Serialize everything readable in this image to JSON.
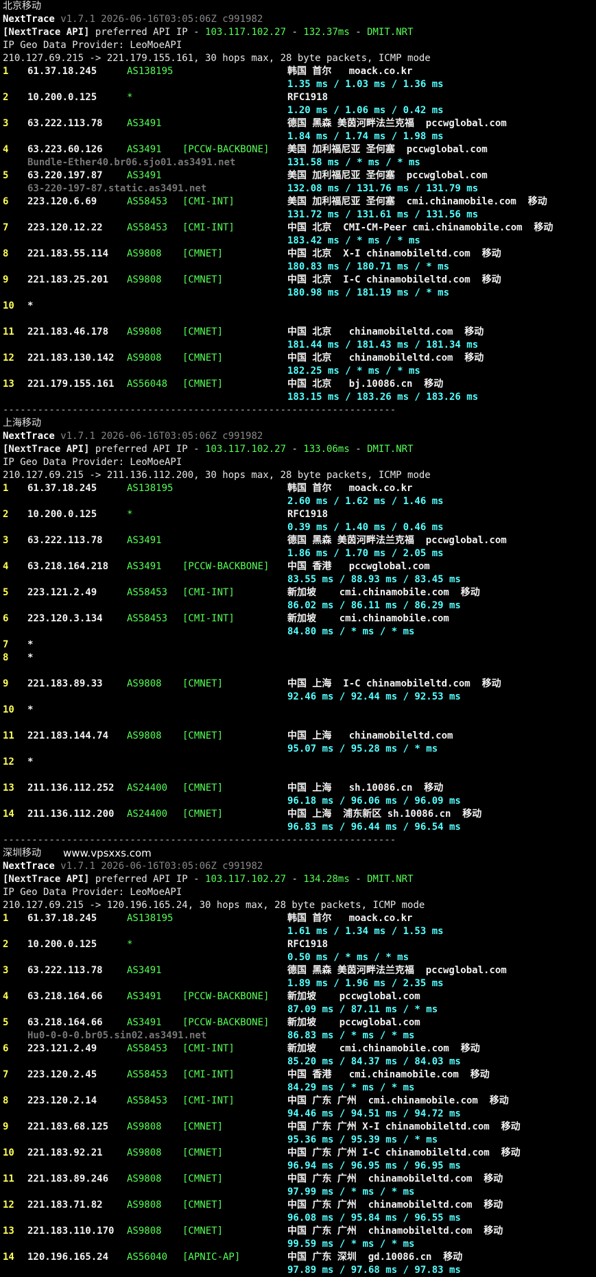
{
  "watermark": "www.vpsxxs.com",
  "sections": [
    {
      "title": "北京移动",
      "nt_name": "NextTrace",
      "nt_version": "v1.7.1 2026-06-16T03:05:06Z c991982",
      "api_prefix": "[NextTrace API]",
      "api_mid": " preferred API IP - ",
      "api_ip": "103.117.102.27",
      "api_sep": " - ",
      "api_ms": "132.37ms",
      "api_sep2": " - ",
      "api_dc": "DMIT.NRT",
      "geo_provider": "IP Geo Data Provider: LeoMoeAPI",
      "trace_header": "210.127.69.215 -> 221.179.155.161, 30 hops max, 28 byte packets, ICMP mode",
      "separator": "--------------------------------------------------------------------",
      "hops": [
        {
          "n": "1",
          "ip": "61.37.18.245",
          "as": "AS138195",
          "tag": "",
          "geo": "韩国 首尔   moack.co.kr",
          "rdns": "",
          "rtt": "1.35 ms / 1.03 ms / 1.36 ms"
        },
        {
          "n": "2",
          "ip": "10.200.0.125",
          "as": "*",
          "tag": "",
          "geo": "RFC1918",
          "rdns": "",
          "rtt": "1.20 ms / 1.06 ms / 0.42 ms"
        },
        {
          "n": "3",
          "ip": "63.222.113.78",
          "as": "AS3491",
          "tag": "",
          "geo": "德国 黑森 美茵河畔法兰克福  pccwglobal.com",
          "rdns": "",
          "rtt": "1.84 ms / 1.74 ms / 1.98 ms"
        },
        {
          "n": "4",
          "ip": "63.223.60.126",
          "as": "AS3491",
          "tag": "[PCCW-BACKBONE]",
          "geo": "美国 加利福尼亚 圣何塞  pccwglobal.com",
          "rdns": "Bundle-Ether40.br06.sjo01.as3491.net",
          "rtt": "131.58 ms / * ms / * ms"
        },
        {
          "n": "5",
          "ip": "63.220.197.87",
          "as": "AS3491",
          "tag": "",
          "geo": "美国 加利福尼亚 圣何塞  pccwglobal.com",
          "rdns": "63-220-197-87.static.as3491.net",
          "rtt": "132.08 ms / 131.76 ms / 131.79 ms"
        },
        {
          "n": "6",
          "ip": "223.120.6.69",
          "as": "AS58453",
          "tag": "[CMI-INT]",
          "geo": "美国 加利福尼亚 圣何塞  cmi.chinamobile.com  移动",
          "rdns": "",
          "rtt": "131.72 ms / 131.61 ms / 131.56 ms"
        },
        {
          "n": "7",
          "ip": "223.120.12.22",
          "as": "AS58453",
          "tag": "[CMI-INT]",
          "geo": "中国 北京  CMI-CM-Peer cmi.chinamobile.com  移动",
          "rdns": "",
          "rtt": "183.42 ms / * ms / * ms"
        },
        {
          "n": "8",
          "ip": "221.183.55.114",
          "as": "AS9808",
          "tag": "[CMNET]",
          "geo": "中国 北京  X-I chinamobileltd.com  移动",
          "rdns": "",
          "rtt": "180.83 ms / 180.71 ms / * ms"
        },
        {
          "n": "9",
          "ip": "221.183.25.201",
          "as": "AS9808",
          "tag": "[CMNET]",
          "geo": "中国 北京  I-C chinamobileltd.com  移动",
          "rdns": "",
          "rtt": "180.98 ms / 181.19 ms / * ms"
        },
        {
          "n": "10",
          "ip": "*",
          "as": "",
          "tag": "",
          "geo": "",
          "rdns": "",
          "rtt": ""
        },
        {
          "n": "11",
          "ip": "221.183.46.178",
          "as": "AS9808",
          "tag": "[CMNET]",
          "geo": "中国 北京   chinamobileltd.com  移动",
          "rdns": "",
          "rtt": "181.44 ms / 181.43 ms / 181.34 ms"
        },
        {
          "n": "12",
          "ip": "221.183.130.142",
          "as": "AS9808",
          "tag": "[CMNET]",
          "geo": "中国 北京   chinamobileltd.com  移动",
          "rdns": "",
          "rtt": "182.25 ms / * ms / * ms"
        },
        {
          "n": "13",
          "ip": "221.179.155.161",
          "as": "AS56048",
          "tag": "[CMNET]",
          "geo": "中国 北京   bj.10086.cn  移动",
          "rdns": "",
          "rtt": "183.15 ms / 183.26 ms / 183.26 ms"
        }
      ]
    },
    {
      "title": "上海移动",
      "nt_name": "NextTrace",
      "nt_version": "v1.7.1 2026-06-16T03:05:06Z c991982",
      "api_prefix": "[NextTrace API]",
      "api_mid": " preferred API IP - ",
      "api_ip": "103.117.102.27",
      "api_sep": " - ",
      "api_ms": "133.06ms",
      "api_sep2": " - ",
      "api_dc": "DMIT.NRT",
      "geo_provider": "IP Geo Data Provider: LeoMoeAPI",
      "trace_header": "210.127.69.215 -> 211.136.112.200, 30 hops max, 28 byte packets, ICMP mode",
      "separator": "--------------------------------------------------------------------",
      "hops": [
        {
          "n": "1",
          "ip": "61.37.18.245",
          "as": "AS138195",
          "tag": "",
          "geo": "韩国 首尔   moack.co.kr",
          "rdns": "",
          "rtt": "2.60 ms / 1.62 ms / 1.46 ms"
        },
        {
          "n": "2",
          "ip": "10.200.0.125",
          "as": "*",
          "tag": "",
          "geo": "RFC1918",
          "rdns": "",
          "rtt": "0.39 ms / 1.40 ms / 0.46 ms"
        },
        {
          "n": "3",
          "ip": "63.222.113.78",
          "as": "AS3491",
          "tag": "",
          "geo": "德国 黑森 美茵河畔法兰克福  pccwglobal.com",
          "rdns": "",
          "rtt": "1.86 ms / 1.70 ms / 2.05 ms"
        },
        {
          "n": "4",
          "ip": "63.218.164.218",
          "as": "AS3491",
          "tag": "[PCCW-BACKBONE]",
          "geo": "中国 香港   pccwglobal.com",
          "rdns": "",
          "rtt": "83.55 ms / 88.93 ms / 83.45 ms"
        },
        {
          "n": "5",
          "ip": "223.121.2.49",
          "as": "AS58453",
          "tag": "[CMI-INT]",
          "geo": "新加坡    cmi.chinamobile.com  移动",
          "rdns": "",
          "rtt": "86.02 ms / 86.11 ms / 86.29 ms"
        },
        {
          "n": "6",
          "ip": "223.120.3.134",
          "as": "AS58453",
          "tag": "[CMI-INT]",
          "geo": "新加坡    cmi.chinamobile.com",
          "rdns": "",
          "rtt": "84.80 ms / * ms / * ms"
        },
        {
          "n": "7",
          "ip": "*",
          "as": "",
          "tag": "",
          "geo": "",
          "rdns": "",
          "rtt": "",
          "compact": true
        },
        {
          "n": "8",
          "ip": "*",
          "as": "",
          "tag": "",
          "geo": "",
          "rdns": "",
          "rtt": ""
        },
        {
          "n": "9",
          "ip": "221.183.89.33",
          "as": "AS9808",
          "tag": "[CMNET]",
          "geo": "中国 上海  I-C chinamobileltd.com  移动",
          "rdns": "",
          "rtt": "92.46 ms / 92.44 ms / 92.53 ms"
        },
        {
          "n": "10",
          "ip": "*",
          "as": "",
          "tag": "",
          "geo": "",
          "rdns": "",
          "rtt": ""
        },
        {
          "n": "11",
          "ip": "221.183.144.74",
          "as": "AS9808",
          "tag": "[CMNET]",
          "geo": "中国 上海   chinamobileltd.com",
          "rdns": "",
          "rtt": "95.07 ms / 95.28 ms / * ms"
        },
        {
          "n": "12",
          "ip": "*",
          "as": "",
          "tag": "",
          "geo": "",
          "rdns": "",
          "rtt": ""
        },
        {
          "n": "13",
          "ip": "211.136.112.252",
          "as": "AS24400",
          "tag": "[CMNET]",
          "geo": "中国 上海   sh.10086.cn  移动",
          "rdns": "",
          "rtt": "96.18 ms / 96.06 ms / 96.09 ms"
        },
        {
          "n": "14",
          "ip": "211.136.112.200",
          "as": "AS24400",
          "tag": "[CMNET]",
          "geo": "中国 上海  浦东新区 sh.10086.cn  移动",
          "rdns": "",
          "rtt": "96.83 ms / 96.44 ms / 96.54 ms"
        }
      ]
    },
    {
      "title": "深圳移动",
      "nt_name": "NextTrace",
      "nt_version": "v1.7.1 2026-06-16T03:05:06Z c991982",
      "api_prefix": "[NextTrace API]",
      "api_mid": " preferred API IP - ",
      "api_ip": "103.117.102.27",
      "api_sep": " - ",
      "api_ms": "134.28ms",
      "api_sep2": " - ",
      "api_dc": "DMIT.NRT",
      "geo_provider": "IP Geo Data Provider: LeoMoeAPI",
      "trace_header": "210.127.69.215 -> 120.196.165.24, 30 hops max, 28 byte packets, ICMP mode",
      "separator": "",
      "hops": [
        {
          "n": "1",
          "ip": "61.37.18.245",
          "as": "AS138195",
          "tag": "",
          "geo": "韩国 首尔   moack.co.kr",
          "rdns": "",
          "rtt": "1.61 ms / 1.34 ms / 1.53 ms"
        },
        {
          "n": "2",
          "ip": "10.200.0.125",
          "as": "*",
          "tag": "",
          "geo": "RFC1918",
          "rdns": "",
          "rtt": "0.50 ms / * ms / * ms"
        },
        {
          "n": "3",
          "ip": "63.222.113.78",
          "as": "AS3491",
          "tag": "",
          "geo": "德国 黑森 美茵河畔法兰克福  pccwglobal.com",
          "rdns": "",
          "rtt": "1.89 ms / 1.96 ms / 2.35 ms"
        },
        {
          "n": "4",
          "ip": "63.218.164.66",
          "as": "AS3491",
          "tag": "[PCCW-BACKBONE]",
          "geo": "新加坡    pccwglobal.com",
          "rdns": "",
          "rtt": "87.09 ms / 87.11 ms / * ms"
        },
        {
          "n": "5",
          "ip": "63.218.164.66",
          "as": "AS3491",
          "tag": "[PCCW-BACKBONE]",
          "geo": "新加坡    pccwglobal.com",
          "rdns": "Hu0-0-0-0.br05.sin02.as3491.net",
          "rtt": "86.83 ms / * ms / * ms"
        },
        {
          "n": "6",
          "ip": "223.121.2.49",
          "as": "AS58453",
          "tag": "[CMI-INT]",
          "geo": "新加坡    cmi.chinamobile.com  移动",
          "rdns": "",
          "rtt": "85.20 ms / 84.37 ms / 84.03 ms"
        },
        {
          "n": "7",
          "ip": "223.120.2.45",
          "as": "AS58453",
          "tag": "[CMI-INT]",
          "geo": "中国 香港   cmi.chinamobile.com  移动",
          "rdns": "",
          "rtt": "84.29 ms / * ms / * ms"
        },
        {
          "n": "8",
          "ip": "223.120.2.14",
          "as": "AS58453",
          "tag": "[CMI-INT]",
          "geo": "中国 广东 广州  cmi.chinamobile.com  移动",
          "rdns": "",
          "rtt": "94.46 ms / 94.51 ms / 94.72 ms"
        },
        {
          "n": "9",
          "ip": "221.183.68.125",
          "as": "AS9808",
          "tag": "[CMNET]",
          "geo": "中国 广东 广州 X-I chinamobileltd.com  移动",
          "rdns": "",
          "rtt": "95.36 ms / 95.39 ms / * ms"
        },
        {
          "n": "10",
          "ip": "221.183.92.21",
          "as": "AS9808",
          "tag": "[CMNET]",
          "geo": "中国 广东 广州 I-C chinamobileltd.com  移动",
          "rdns": "",
          "rtt": "96.94 ms / 96.95 ms / 96.95 ms"
        },
        {
          "n": "11",
          "ip": "221.183.89.246",
          "as": "AS9808",
          "tag": "[CMNET]",
          "geo": "中国 广东 广州  chinamobileltd.com  移动",
          "rdns": "",
          "rtt": "97.99 ms / * ms / * ms"
        },
        {
          "n": "12",
          "ip": "221.183.71.82",
          "as": "AS9808",
          "tag": "[CMNET]",
          "geo": "中国 广东 广州  chinamobileltd.com  移动",
          "rdns": "",
          "rtt": "96.08 ms / 95.84 ms / 96.55 ms"
        },
        {
          "n": "13",
          "ip": "221.183.110.170",
          "as": "AS9808",
          "tag": "[CMNET]",
          "geo": "中国 广东 广州  chinamobileltd.com  移动",
          "rdns": "",
          "rtt": "99.59 ms / * ms / * ms"
        },
        {
          "n": "14",
          "ip": "120.196.165.24",
          "as": "AS56040",
          "tag": "[APNIC-AP]",
          "geo": "中国 广东 深圳  gd.10086.cn  移动",
          "rdns": "",
          "rtt": "97.89 ms / 97.68 ms / 97.83 ms"
        }
      ]
    }
  ]
}
